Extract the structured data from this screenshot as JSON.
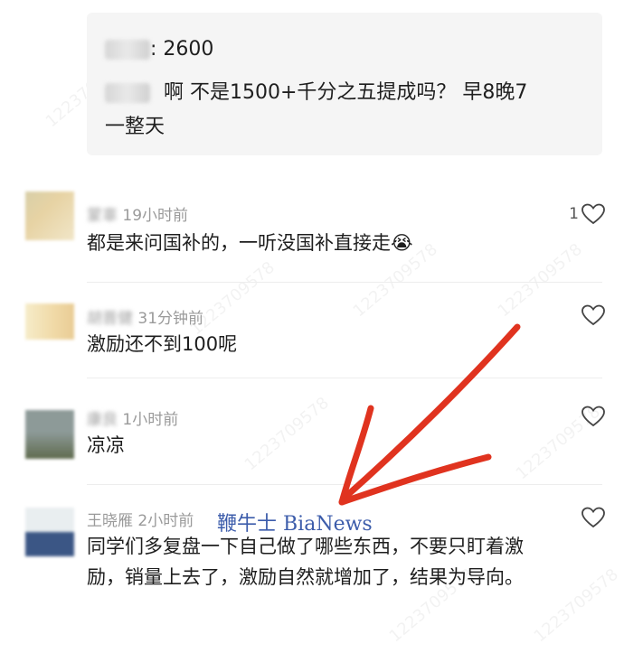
{
  "quote": {
    "line1_value": ": 2600",
    "line2_text": "啊 不是1500+千分之五提成吗？ 早8晚7",
    "line3_text": "一整天"
  },
  "comments": [
    {
      "name": "蒙辜",
      "time": "19小时前",
      "text": "都是来问国补的，一听没国补直接走😭",
      "likes": "1"
    },
    {
      "name": "胡晋健",
      "time": "31分钟前",
      "text": "激励还不到100呢",
      "likes": ""
    },
    {
      "name": "康良",
      "time": "1小时前",
      "text": "凉凉",
      "likes": ""
    },
    {
      "name": "王晓雁",
      "time": "2小时前",
      "text": "同学们多复盘一下自己做了哪些东西，不要只盯着激励，销量上去了，激励自然就增加了，结果为导向。",
      "likes": ""
    }
  ],
  "watermark_text": "1223709578",
  "overlay_logo": "鞭牛士 BiaNews",
  "colors": {
    "arrow": "#e0331f",
    "logo": "#3d5dab",
    "meta": "#9a9a9a"
  },
  "icons": {
    "like": "heart-outline-icon"
  }
}
